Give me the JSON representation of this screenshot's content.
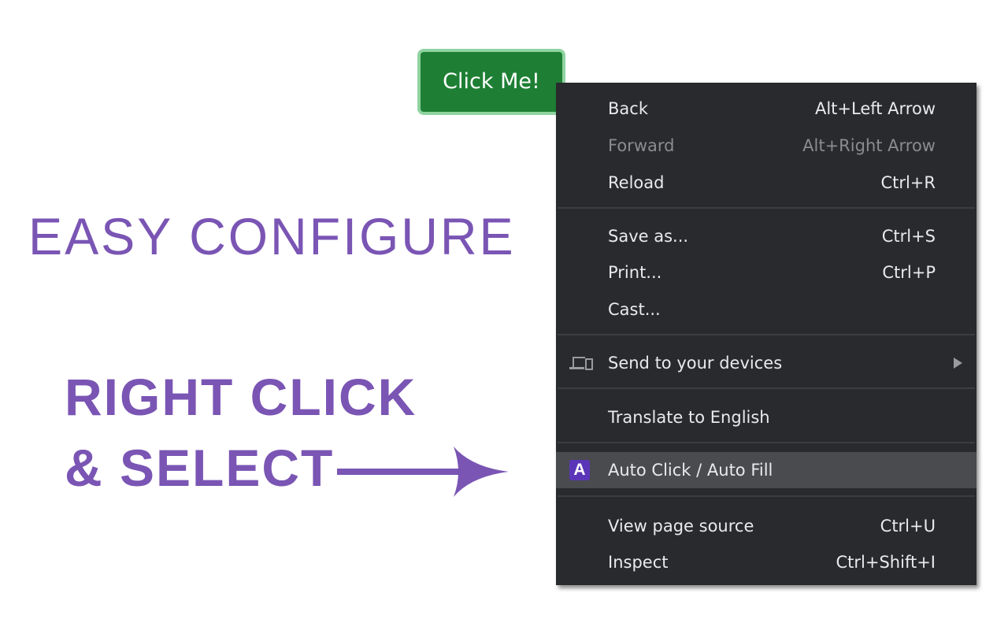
{
  "page": {
    "button_label": "Click Me!",
    "headline_light": "EASY CONFIGURE",
    "headline_bold_line1": "RIGHT CLICK",
    "headline_bold_line2": "& SELECT",
    "accent_color": "#7a55b4",
    "button_color": "#1e7f34"
  },
  "context_menu": {
    "items": [
      {
        "label": "Back",
        "shortcut": "Alt+Left Arrow",
        "disabled": false
      },
      {
        "label": "Forward",
        "shortcut": "Alt+Right Arrow",
        "disabled": true
      },
      {
        "label": "Reload",
        "shortcut": "Ctrl+R",
        "disabled": false
      },
      {
        "label": "Save as...",
        "shortcut": "Ctrl+S",
        "disabled": false
      },
      {
        "label": "Print...",
        "shortcut": "Ctrl+P",
        "disabled": false
      },
      {
        "label": "Cast...",
        "shortcut": "",
        "disabled": false
      },
      {
        "label": "Send to your devices",
        "icon": "devices-icon",
        "has_submenu": true
      },
      {
        "label": "Translate to English",
        "shortcut": ""
      },
      {
        "label": "Auto Click / Auto Fill",
        "icon": "extension-a-icon",
        "icon_letter": "A",
        "highlighted": true
      },
      {
        "label": "View page source",
        "shortcut": "Ctrl+U"
      },
      {
        "label": "Inspect",
        "shortcut": "Ctrl+Shift+I"
      }
    ]
  }
}
